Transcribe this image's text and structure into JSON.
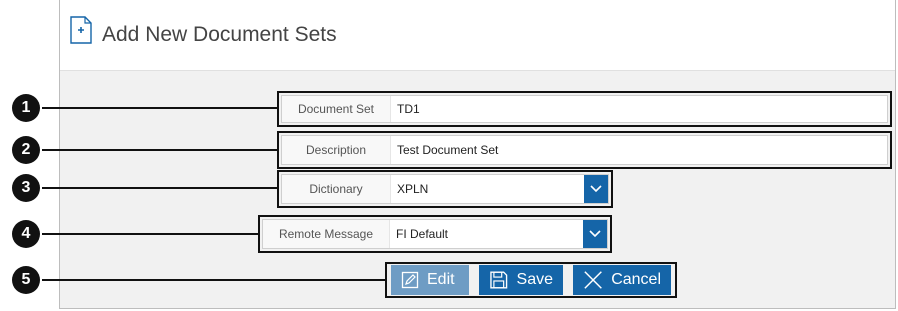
{
  "header": {
    "title": "Add New Document Sets"
  },
  "callouts": [
    "1",
    "2",
    "3",
    "4",
    "5"
  ],
  "fields": {
    "document_set": {
      "label": "Document Set",
      "value": "TD1"
    },
    "description": {
      "label": "Description",
      "value": "Test Document Set"
    },
    "dictionary": {
      "label": "Dictionary",
      "value": "XPLN"
    },
    "remote_message": {
      "label": "Remote Message",
      "value": "FI Default"
    }
  },
  "buttons": {
    "edit": "Edit",
    "save": "Save",
    "cancel": "Cancel"
  },
  "colors": {
    "primary": "#1565a8",
    "disabled": "#6e9cc4",
    "panel_bg": "#f1f1f1"
  },
  "icons": {
    "header": "document-add-icon",
    "edit": "pencil-icon",
    "save": "floppy-disk-icon",
    "cancel": "close-icon",
    "dropdown": "chevron-down-icon"
  }
}
